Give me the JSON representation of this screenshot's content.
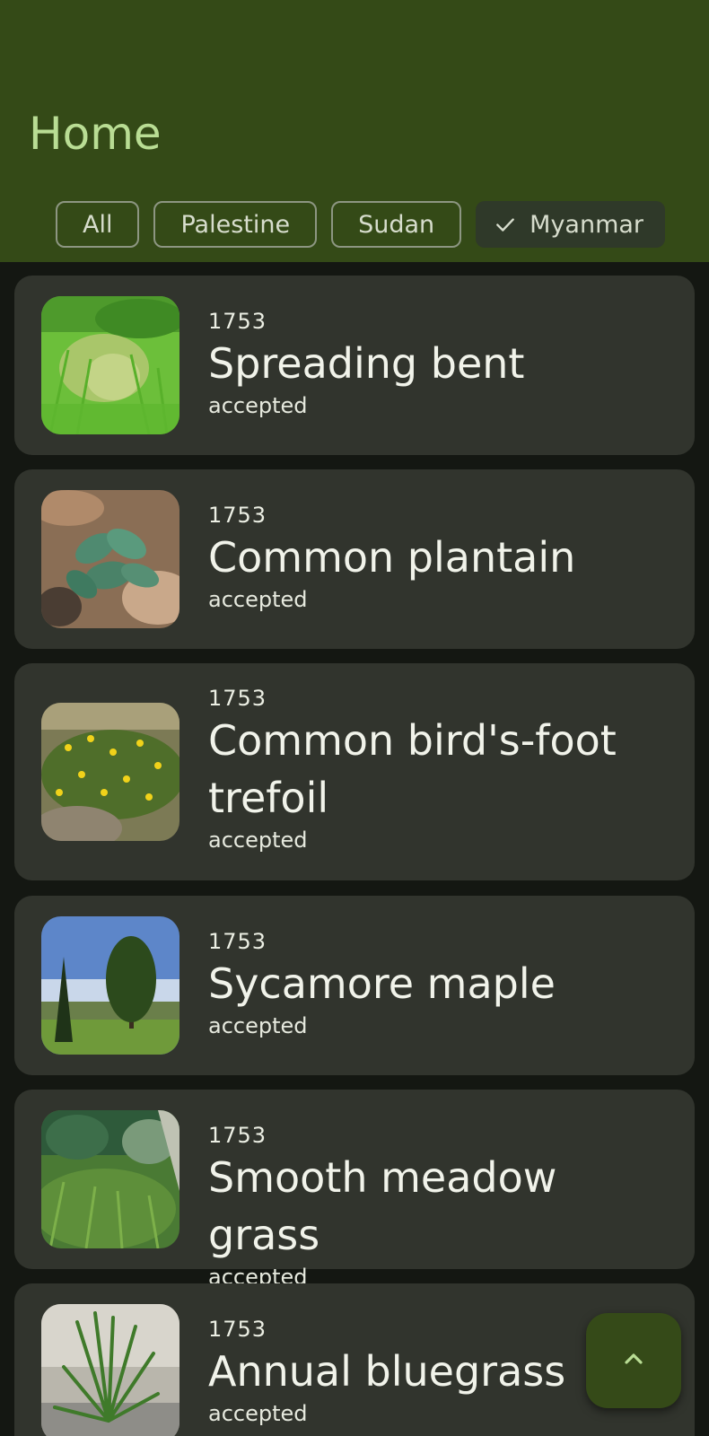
{
  "header": {
    "title": "Home"
  },
  "filters": [
    {
      "label": "All",
      "selected": false
    },
    {
      "label": "Palestine",
      "selected": false
    },
    {
      "label": "Sudan",
      "selected": false
    },
    {
      "label": "Myanmar",
      "selected": true
    }
  ],
  "plants": [
    {
      "year": "1753",
      "name": "Spreading bent",
      "status": "accepted",
      "image": "grass-field-photo"
    },
    {
      "year": "1753",
      "name": "Common plantain",
      "status": "accepted",
      "image": "plantain-leaves-photo"
    },
    {
      "year": "1753",
      "name": "Common bird's-foot trefoil",
      "status": "accepted",
      "image": "yellow-flowers-photo"
    },
    {
      "year": "1753",
      "name": "Sycamore maple",
      "status": "accepted",
      "image": "tree-landscape-photo"
    },
    {
      "year": "1753",
      "name": "Smooth meadow grass",
      "status": "accepted",
      "image": "meadow-photo"
    },
    {
      "year": "1753",
      "name": "Annual bluegrass",
      "status": "accepted",
      "image": "grass-tuft-photo"
    }
  ],
  "fab": {
    "icon": "chevron-up-icon"
  },
  "colors": {
    "topbar": "#344a17",
    "title": "#b9dd94",
    "background": "#141712",
    "card": "#31342d",
    "fab": "#354a18"
  }
}
